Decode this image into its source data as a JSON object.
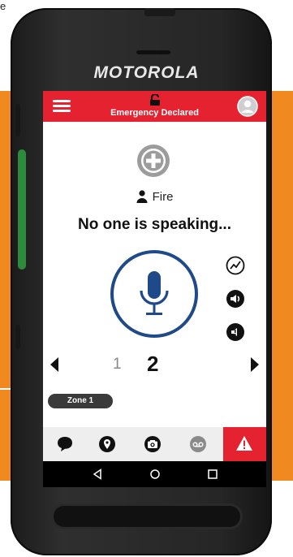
{
  "page": {
    "corner_text": "e"
  },
  "device": {
    "brand": "MOTOROLA"
  },
  "header": {
    "title": "Emergency Declared",
    "menu_icon": "hamburger-menu-icon",
    "lock_icon": "unlock-icon",
    "profile_icon": "profile-icon"
  },
  "main": {
    "group_icon": "plus-circle-icon",
    "talkgroup": "Fire",
    "status_text": "No one is speaking...",
    "ptt_icon": "microphone-icon"
  },
  "side_actions": [
    "signal-graph-icon",
    "speaker-icon",
    "alert-speaker-icon"
  ],
  "channel": {
    "previous": "1",
    "current": "2"
  },
  "zone": {
    "label": "Zone 1"
  },
  "bottom_nav": [
    "chat-icon",
    "location-pin-icon",
    "camera-icon",
    "voicemail-icon",
    "emergency-alert-icon"
  ],
  "android_nav": [
    "back-icon",
    "home-icon",
    "recents-icon"
  ],
  "colors": {
    "accent": "#e52330",
    "ptt_ring": "#1f4a8a",
    "background": "#f0891f"
  }
}
